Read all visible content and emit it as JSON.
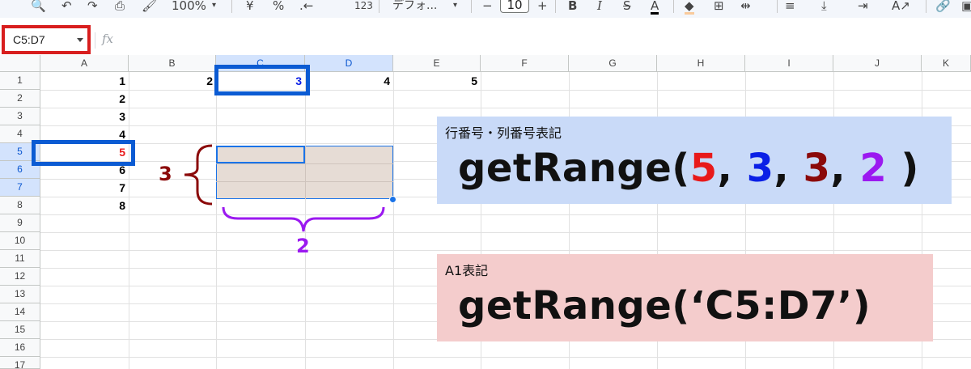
{
  "toolbar": {
    "zoom": "100%",
    "currency": "¥",
    "percent": "%",
    "format_number": "123",
    "font_name": "デフォ...",
    "font_size": "10",
    "minus": "−",
    "plus": "+",
    "bold": "B",
    "italic": "I",
    "strikethrough": "S",
    "text_color": "A"
  },
  "formula_bar": {
    "name_box": "C5:D7",
    "fx": "fx"
  },
  "grid": {
    "columns": [
      "A",
      "B",
      "C",
      "D",
      "E",
      "F",
      "G",
      "H",
      "I",
      "J",
      "K"
    ],
    "rows": [
      "1",
      "2",
      "3",
      "4",
      "5",
      "6",
      "7",
      "8",
      "9",
      "10",
      "11",
      "12",
      "13",
      "14",
      "15",
      "16",
      "17"
    ],
    "row1_values": [
      "1",
      "2",
      "3",
      "4",
      "5"
    ],
    "colA_values": [
      "1",
      "2",
      "3",
      "4",
      "5",
      "6",
      "7",
      "8"
    ]
  },
  "annotations": {
    "row_count": "3",
    "col_count": "2"
  },
  "panel_rowcol": {
    "label": "行番号・列番号表記",
    "code_prefix": "getRange(",
    "arg1": "5",
    "arg2": "3",
    "arg3": "3",
    "arg4": "2",
    "comma": ", ",
    "code_suffix": " )"
  },
  "panel_a1": {
    "label": "A1表記",
    "code": "getRange(‘C5:D7’)"
  },
  "colors": {
    "red": "#e8191a",
    "blue": "#0a1fe6",
    "darkred": "#8b0a0a",
    "purple": "#9b19f0",
    "highlight_blue": "#0b5bd3",
    "panel_blue": "#c9daf8",
    "panel_pink": "#f4cccc"
  }
}
